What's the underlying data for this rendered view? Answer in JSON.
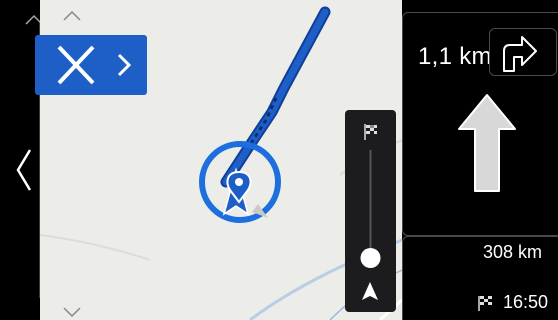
{
  "guidance": {
    "distance_to_turn": "1,1 km",
    "next_maneuver_icon": "turn-right-icon",
    "main_maneuver_icon": "straight-arrow-icon"
  },
  "trip": {
    "remaining_distance": "308 km",
    "arrival_time": "16:50",
    "destination_icon": "checkered-flag-icon"
  },
  "controls": {
    "close_icon": "close-icon",
    "expand_icon": "chevron-right-icon",
    "panel_up_icon": "chevron-up-icon",
    "panel_left_icon": "chevron-left-icon",
    "panel_down_icon": "chevron-down-icon"
  },
  "route_slider": {
    "start_icon": "navigation-arrow-icon",
    "end_icon": "checkered-flag-icon",
    "progress": 0.0
  },
  "colors": {
    "route": "#1d5fc7",
    "route_dark": "#0f3f9a",
    "map_background": "#ecece9",
    "accent_blue": "#1d5fc7",
    "panel_border": "#4a4a4a"
  }
}
